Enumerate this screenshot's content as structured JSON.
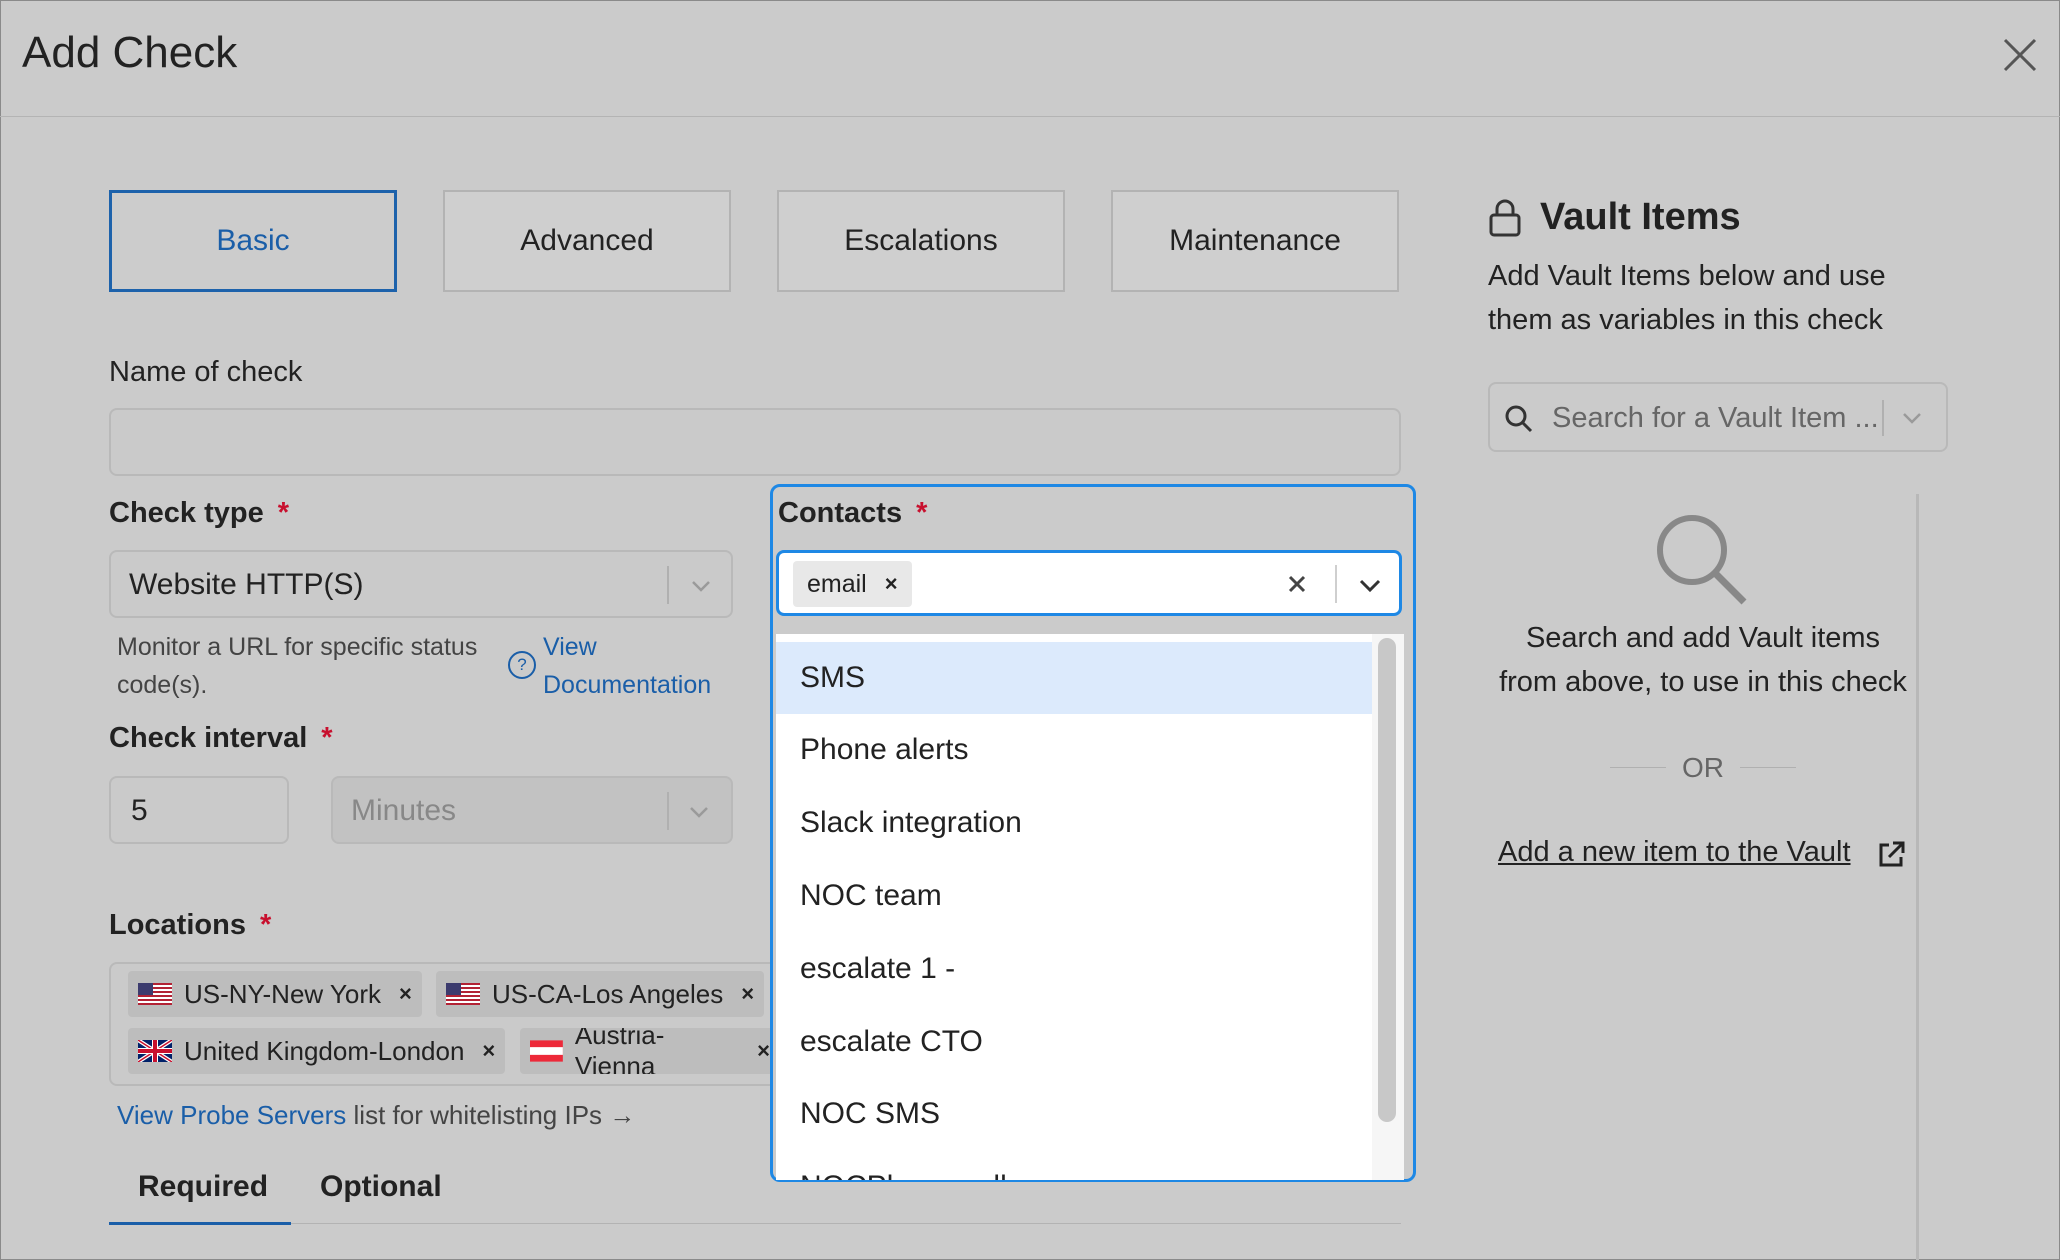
{
  "dialog": {
    "title": "Add Check"
  },
  "tabs": [
    {
      "label": "Basic"
    },
    {
      "label": "Advanced"
    },
    {
      "label": "Escalations"
    },
    {
      "label": "Maintenance"
    }
  ],
  "name_of_check": {
    "label": "Name of check",
    "value": ""
  },
  "check_type": {
    "label": "Check type",
    "required_mark": "*",
    "value": "Website HTTP(S)",
    "help_text_1": "Monitor a URL for specific status",
    "help_text_2": "code(s).",
    "help_icon": "?",
    "doc_link_1": "View",
    "doc_link_2": "Documentation"
  },
  "check_interval": {
    "label": "Check interval",
    "required_mark": "*",
    "value": "5",
    "unit_placeholder": "Minutes"
  },
  "locations": {
    "label": "Locations",
    "required_mark": "*",
    "chips": [
      {
        "label": "US-NY-New York"
      },
      {
        "label": "US-CA-Los Angeles"
      },
      {
        "label": "United Kingdom-London"
      },
      {
        "label": "Austria-Vienna"
      }
    ],
    "probe_link": "View Probe Servers",
    "probe_text": "list for whitelisting IPs →"
  },
  "bottom_tabs": [
    {
      "label": "Required"
    },
    {
      "label": "Optional"
    }
  ],
  "contacts": {
    "label": "Contacts",
    "required_mark": "*",
    "selected": [
      {
        "label": "email"
      }
    ],
    "options": [
      {
        "label": "SMS"
      },
      {
        "label": "Phone alerts"
      },
      {
        "label": "Slack integration"
      },
      {
        "label": "NOC team"
      },
      {
        "label": "escalate 1 -"
      },
      {
        "label": "escalate CTO"
      },
      {
        "label": "NOC SMS"
      },
      {
        "label": "NOCPhone call"
      }
    ]
  },
  "vault": {
    "title": "Vault Items",
    "subtitle_1": "Add Vault Items below and use",
    "subtitle_2": "them as variables in this check",
    "search_placeholder": "Search for a Vault Item ...",
    "empty_text_1": "Search and add Vault items",
    "empty_text_2": "from above, to use in this check",
    "or_text": "OR",
    "add_link": "Add a new item to the Vault"
  },
  "colors": {
    "accent": "#1e88e5",
    "link": "#1a5ea8",
    "required": "#c8102e",
    "highlight": "#dceafc"
  }
}
